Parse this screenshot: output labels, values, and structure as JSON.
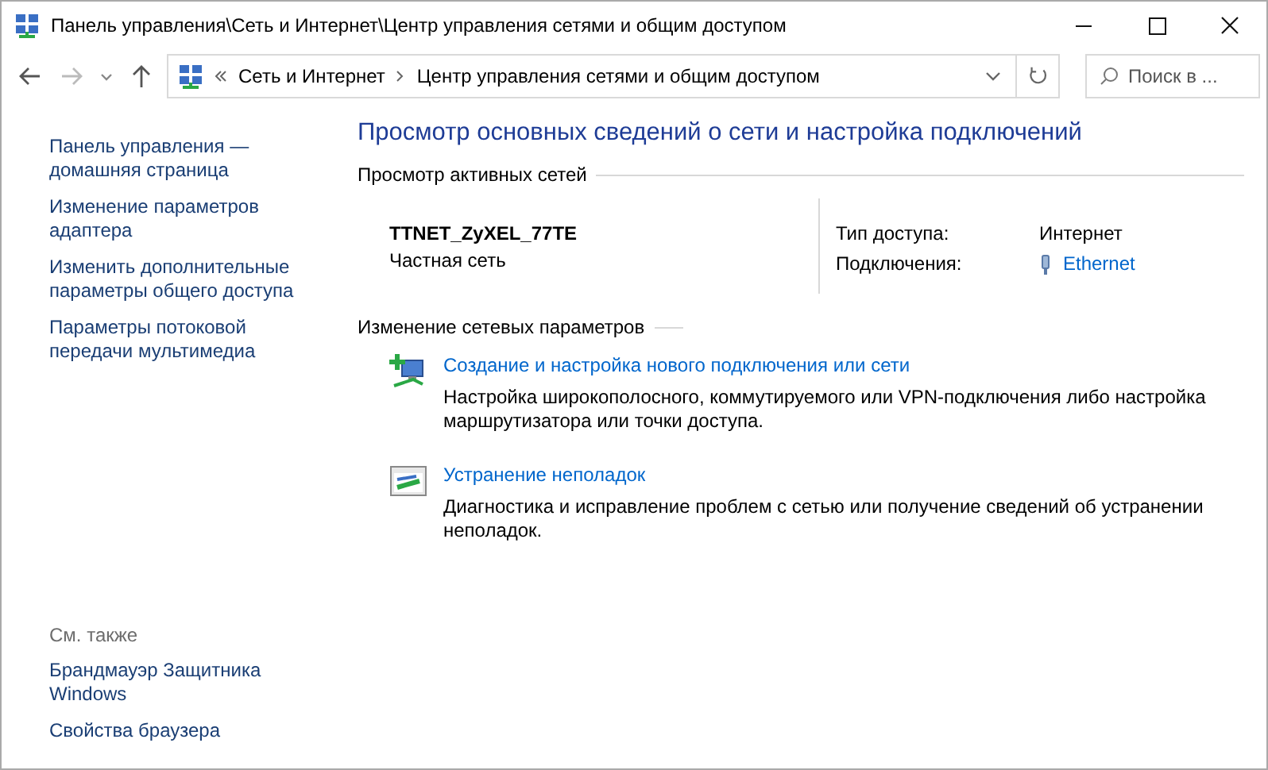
{
  "window": {
    "title": "Панель управления\\Сеть и Интернет\\Центр управления сетями и общим доступом"
  },
  "address": {
    "breadcrumbs": [
      "Сеть и Интернет",
      "Центр управления сетями и общим доступом"
    ]
  },
  "search": {
    "placeholder": "Поиск в ..."
  },
  "sidebar": {
    "links": [
      "Панель управления — домашняя страница",
      "Изменение параметров адаптера",
      "Изменить дополнительные параметры общего доступа",
      "Параметры потоковой передачи мультимедиа"
    ],
    "see_also": {
      "title": "См. также",
      "links": [
        "Брандмауэр Защитника Windows",
        "Свойства браузера"
      ]
    }
  },
  "main": {
    "heading": "Просмотр основных сведений о сети и настройка подключений",
    "active_networks": {
      "title": "Просмотр активных сетей",
      "network_name": "TTNET_ZyXEL_77TE",
      "network_type": "Частная сеть",
      "properties": [
        {
          "label": "Тип доступа:",
          "value": "Интернет",
          "kind": "text"
        },
        {
          "label": "Подключения:",
          "value": "Ethernet",
          "kind": "link"
        }
      ]
    },
    "change_settings": {
      "title": "Изменение сетевых параметров",
      "tasks": [
        {
          "kind": "new-connection",
          "title": "Создание и настройка нового подключения или сети",
          "description": "Настройка широкополосного, коммутируемого или VPN-подключения либо настройка маршрутизатора или точки доступа."
        },
        {
          "kind": "troubleshoot",
          "title": "Устранение неполадок",
          "description": "Диагностика и исправление проблем с сетью или получение сведений об устранении неполадок."
        }
      ]
    }
  }
}
